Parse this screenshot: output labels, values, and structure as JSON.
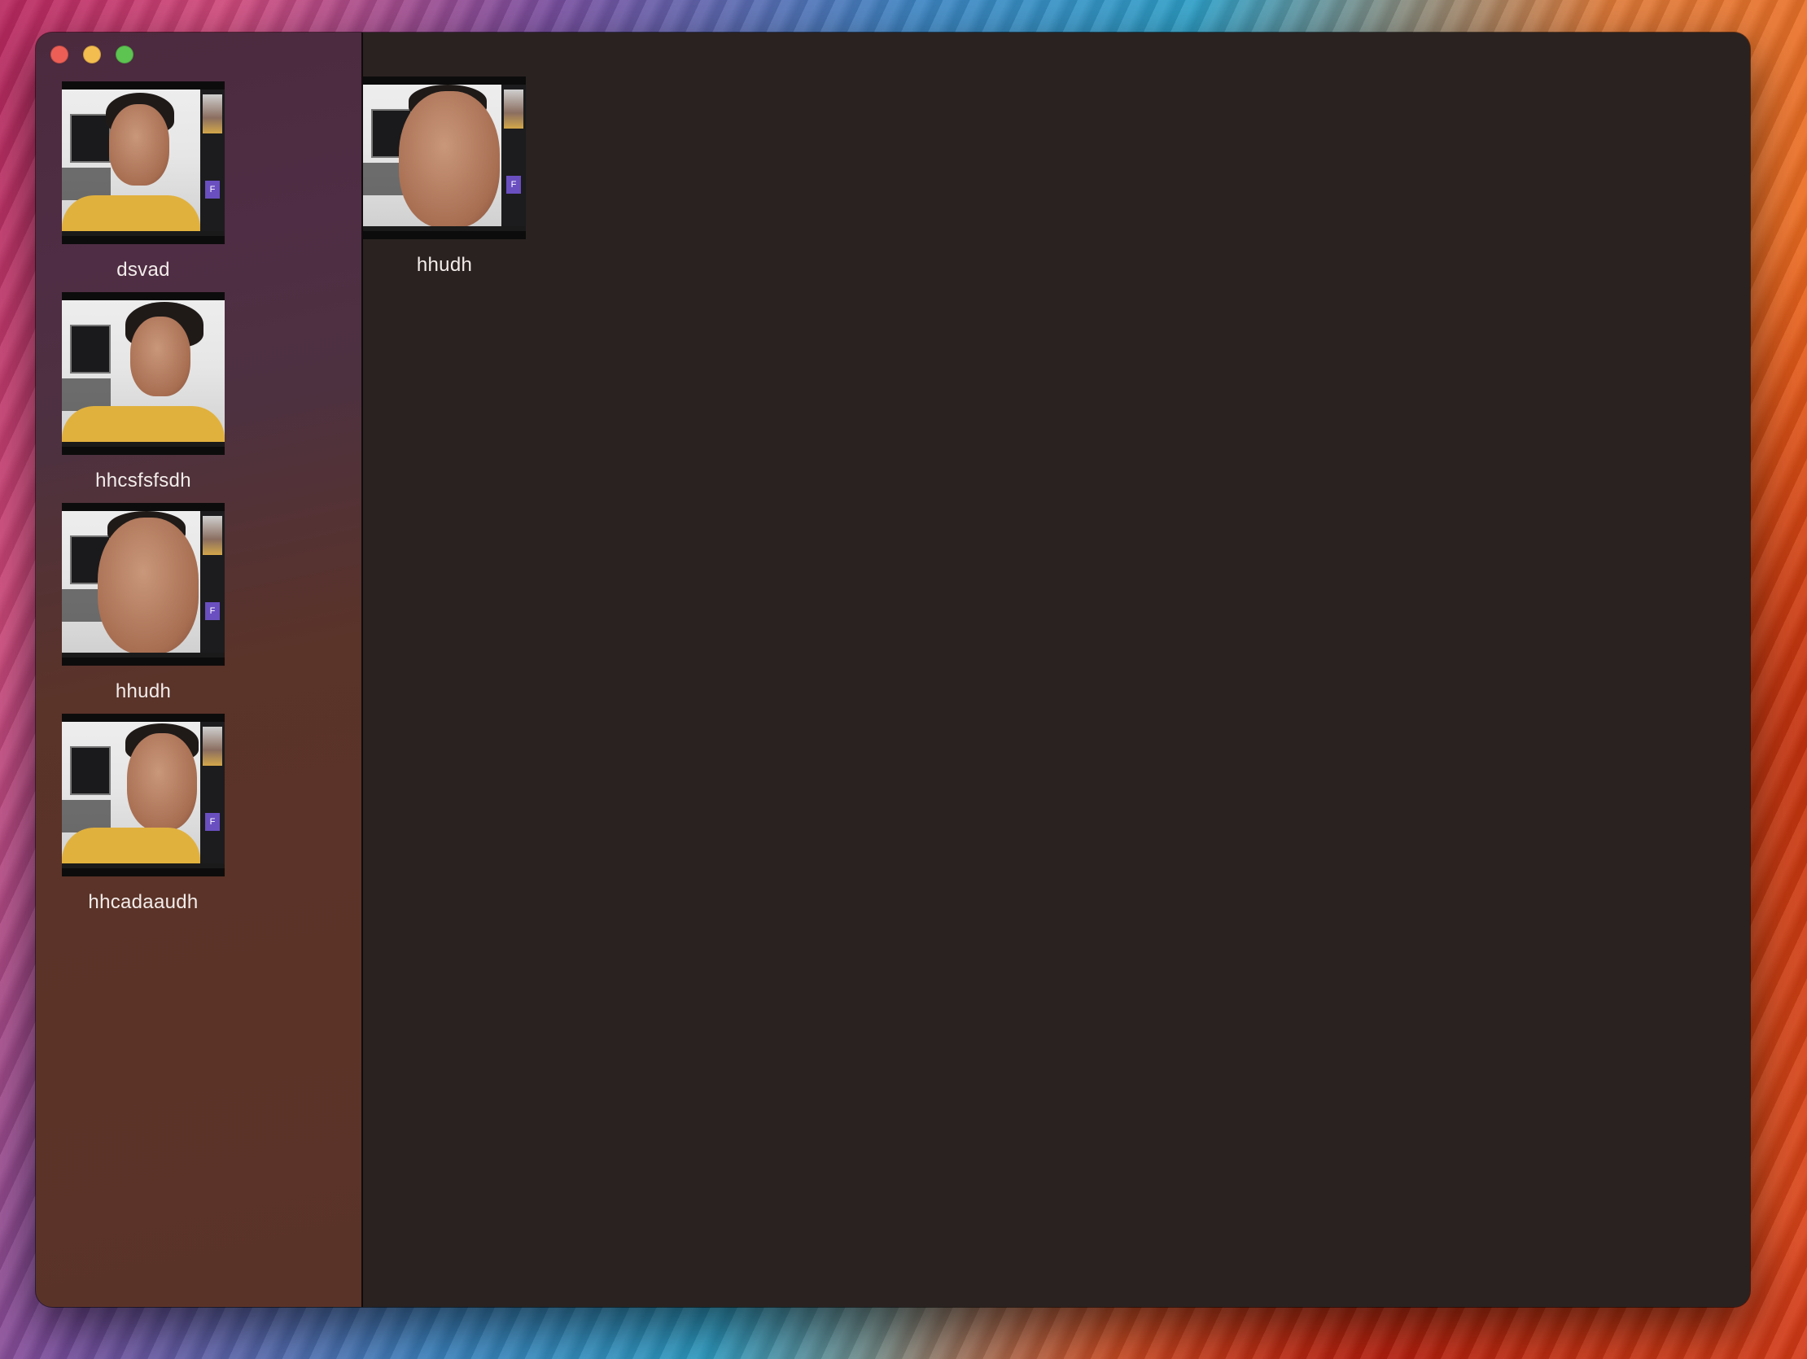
{
  "window": {
    "controls": {
      "close_icon": "close-icon",
      "minimize_icon": "minimize-icon",
      "zoom_icon": "zoom-icon",
      "close_color": "#ed5f56",
      "minimize_color": "#f4bd4f",
      "zoom_color": "#5dc451"
    }
  },
  "sidebar": {
    "items": [
      {
        "label": "dsvad",
        "preview_avatar_letter": "F"
      },
      {
        "label": "hhcsfsfsdh",
        "preview_avatar_letter": ""
      },
      {
        "label": "hhudh",
        "preview_avatar_letter": "F"
      },
      {
        "label": "hhcadaaudh",
        "preview_avatar_letter": "F"
      }
    ]
  },
  "main": {
    "items": [
      {
        "label": "hhudh",
        "preview_avatar_letter": "F"
      }
    ]
  },
  "colors": {
    "main_background": "#2a2221",
    "sidebar_gradient_top": "#4b2a3e",
    "sidebar_gradient_bottom": "#5a3328",
    "avatar_purple": "#6a4fc0"
  }
}
